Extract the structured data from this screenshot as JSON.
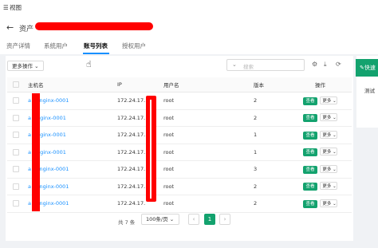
{
  "topbar": {
    "menu_icon": "menu-icon",
    "menu_label": "视图"
  },
  "header": {
    "back_icon": "arrow-left-icon",
    "title": "资产"
  },
  "tabs": [
    {
      "label": "资产详情"
    },
    {
      "label": "系统用户"
    },
    {
      "label": "账号列表",
      "active": true
    },
    {
      "label": "授权用户"
    }
  ],
  "toolbar": {
    "more_actions": "更多操作",
    "search_placeholder": "搜索"
  },
  "table": {
    "headers": [
      "主机名",
      "IP",
      "用户名",
      "版本",
      "操作"
    ],
    "rows": [
      {
        "host": "a ct-nginx-0001",
        "ip": "172.24.17.",
        "user": "root",
        "version": "2"
      },
      {
        "host": "a t-nginx-0001",
        "ip": "172.24.17.",
        "user": "root",
        "version": "2"
      },
      {
        "host": "a t-nginx-0001",
        "ip": "172.24.17.",
        "user": "root",
        "version": "1"
      },
      {
        "host": "a t-nginx-0001",
        "ip": "172.24.17.",
        "user": "root",
        "version": "1"
      },
      {
        "host": "a ct-nginx-0001",
        "ip": "172.24.17.",
        "user": "root",
        "version": "3"
      },
      {
        "host": "a ct-nginx-0001",
        "ip": "172.24.17.",
        "user": "root",
        "version": "2"
      },
      {
        "host": "a ct-nginx-0001",
        "ip": "172.24.17.",
        "user": "root",
        "version": "2"
      }
    ],
    "view_label": "查看",
    "more_label": "更多"
  },
  "pager": {
    "total": "共 7 条",
    "page_size": "100条/页",
    "current_page": "1"
  },
  "side": {
    "quick_label": "快速",
    "test_label": "测试"
  },
  "colors": {
    "accent": "#13a26e",
    "link": "#1890ff",
    "redaction": "#ff0000"
  }
}
